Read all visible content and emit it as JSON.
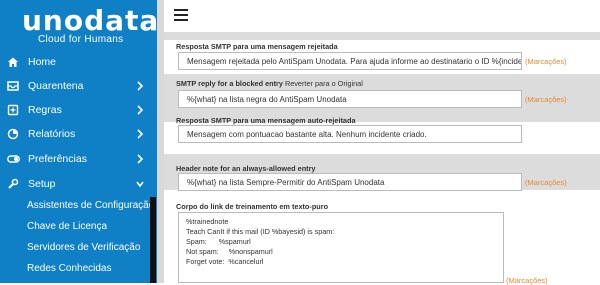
{
  "brand": {
    "name": "unodata",
    "tagline": "Cloud for Humans"
  },
  "sidebar": {
    "items": [
      {
        "label": "Home",
        "icon": "home-icon"
      },
      {
        "label": "Quarentena",
        "icon": "inbox-icon"
      },
      {
        "label": "Regras",
        "icon": "rules-icon"
      },
      {
        "label": "Relatórios",
        "icon": "report-icon"
      },
      {
        "label": "Preferências",
        "icon": "toggle-icon"
      },
      {
        "label": "Setup",
        "icon": "wrench-icon"
      }
    ],
    "setup_subitems": [
      "Assistentes de Configuração",
      "Chave de Licença",
      "Servidores de Verificação",
      "Redes Conhecidas"
    ]
  },
  "settings": [
    {
      "label": "Resposta SMTP para uma mensagem rejeitada",
      "value": "Mensagem rejeitada pelo AntiSpam Unodata.  Para ajuda informe ao destinatario o ID %{incident",
      "marcacoes": "(Marcações)"
    },
    {
      "label": "SMTP reply for a blocked entry",
      "label_suffix": "Reverter para o Original",
      "value": "%{what} na lista negra do AntiSpam Unodata",
      "marcacoes": "(Marcações)"
    },
    {
      "label": "Resposta SMTP para uma mensagem auto-rejeitada",
      "value": "Mensagem com pontuacao bastante alta. Nenhum incidente criado."
    },
    {
      "label": "Header note for an always-allowed entry",
      "value": "%{what} na lista Sempre-Permitir do AntiSpam Unodata",
      "marcacoes": "(Marcações)"
    }
  ],
  "training_link": {
    "label": "Corpo do link de treinamento em texto-puro",
    "lines": [
      "%trainednote",
      "Teach CanIt if this mail (ID %bayesid) is spam:",
      "Spam:      %spamurl",
      "Not spam:     %nonspamurl",
      "Forget vote:  %cancelurl"
    ],
    "marcacoes": "(Marcações)"
  },
  "colors": {
    "sidebar": "#0f7fc6",
    "accent": "#e58a2c",
    "band": "#dcdcdc"
  }
}
